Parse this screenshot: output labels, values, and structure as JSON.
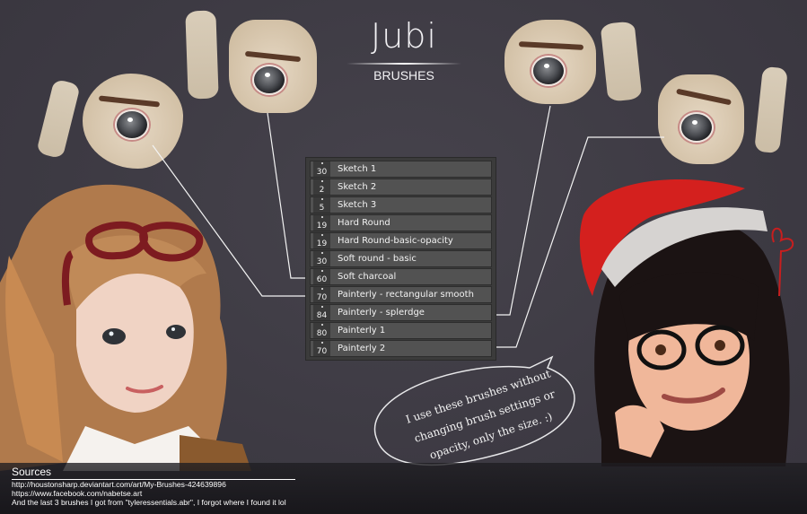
{
  "title": {
    "main": "Jubi",
    "subtitle": "BRUSHES"
  },
  "brush_panel": {
    "brushes": [
      {
        "size": "30",
        "name": "Sketch 1"
      },
      {
        "size": "2",
        "name": "Sketch 2"
      },
      {
        "size": "5",
        "name": "Sketch 3"
      },
      {
        "size": "19",
        "name": "Hard Round"
      },
      {
        "size": "19",
        "name": "Hard Round-basic-opacity"
      },
      {
        "size": "30",
        "name": "Soft round - basic"
      },
      {
        "size": "60",
        "name": "Soft charcoal"
      },
      {
        "size": "70",
        "name": "Painterly - rectangular smooth"
      },
      {
        "size": "84",
        "name": "Painterly - splerdge"
      },
      {
        "size": "80",
        "name": "Painterly 1"
      },
      {
        "size": "70",
        "name": "Painterly 2"
      }
    ]
  },
  "speech_bubble": {
    "lines": [
      "I use these brushes without",
      "changing brush settings or",
      "opacity, only the size. :)"
    ]
  },
  "sources": {
    "heading": "Sources",
    "lines": [
      "http://houstonsharp.deviantart.com/art/My-Brushes-424639896",
      "https://www.facebook.com/nabetse.art",
      "And the last 3 brushes I got from \"tyleressentials.abr\", I forgot where I found it lol"
    ]
  },
  "illustrations": {
    "left_character": "girl with ponytail and red glasses on head",
    "right_character": "girl with santa hat and black glasses"
  },
  "colors": {
    "background": "#3f3c45",
    "swatch": "#d6c9b5",
    "panel": "#3b3b3b",
    "row": "#525252",
    "text": "#f2f2f2",
    "hat_red": "#d4201e"
  }
}
